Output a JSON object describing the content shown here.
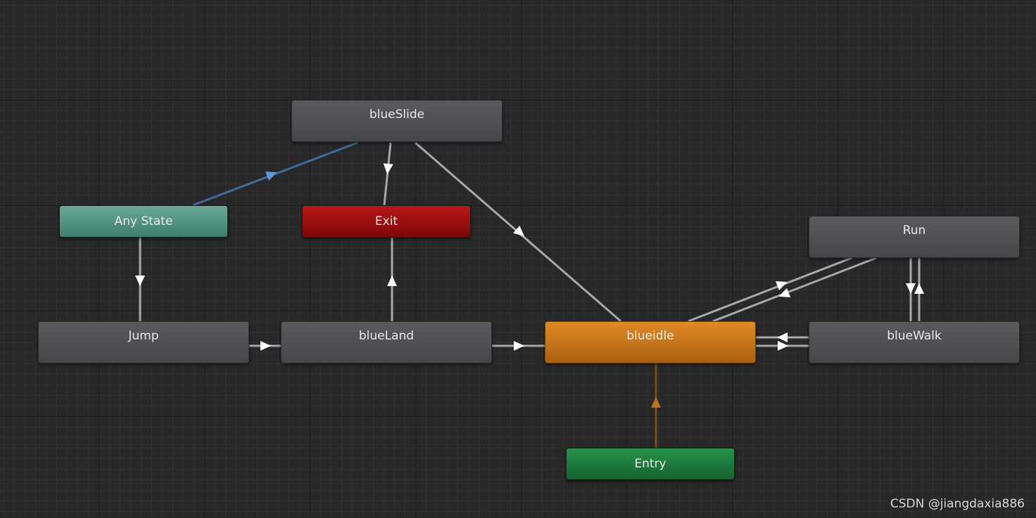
{
  "graph": {
    "nodes": {
      "blueSlide": {
        "label": "blueSlide"
      },
      "anyState": {
        "label": "Any State"
      },
      "exit": {
        "label": "Exit"
      },
      "run": {
        "label": "Run"
      },
      "jump": {
        "label": "Jump"
      },
      "blueLand": {
        "label": "blueLand"
      },
      "blueidle": {
        "label": "blueidle"
      },
      "blueWalk": {
        "label": "blueWalk"
      },
      "entry": {
        "label": "Entry"
      }
    },
    "transitions": [
      {
        "from": "anyState",
        "to": "blueSlide"
      },
      {
        "from": "blueSlide",
        "to": "exit"
      },
      {
        "from": "blueSlide",
        "to": "blueidle"
      },
      {
        "from": "anyState",
        "to": "jump"
      },
      {
        "from": "blueLand",
        "to": "exit"
      },
      {
        "from": "jump",
        "to": "blueLand"
      },
      {
        "from": "blueLand",
        "to": "blueidle"
      },
      {
        "from": "blueidle",
        "to": "run"
      },
      {
        "from": "run",
        "to": "blueidle"
      },
      {
        "from": "run",
        "to": "blueWalk"
      },
      {
        "from": "blueWalk",
        "to": "run"
      },
      {
        "from": "blueWalk",
        "to": "blueidle"
      },
      {
        "from": "blueidle",
        "to": "blueWalk"
      },
      {
        "from": "entry",
        "to": "blueidle"
      }
    ],
    "colors": {
      "wire": "#a8a8a8",
      "any_wire": "#3f6c9c",
      "any_arrow": "#5a9bd8",
      "entry_wire": "#7a4e0c",
      "entry_arrow": "#b87514"
    }
  },
  "watermark": "CSDN @jiangdaxia886"
}
